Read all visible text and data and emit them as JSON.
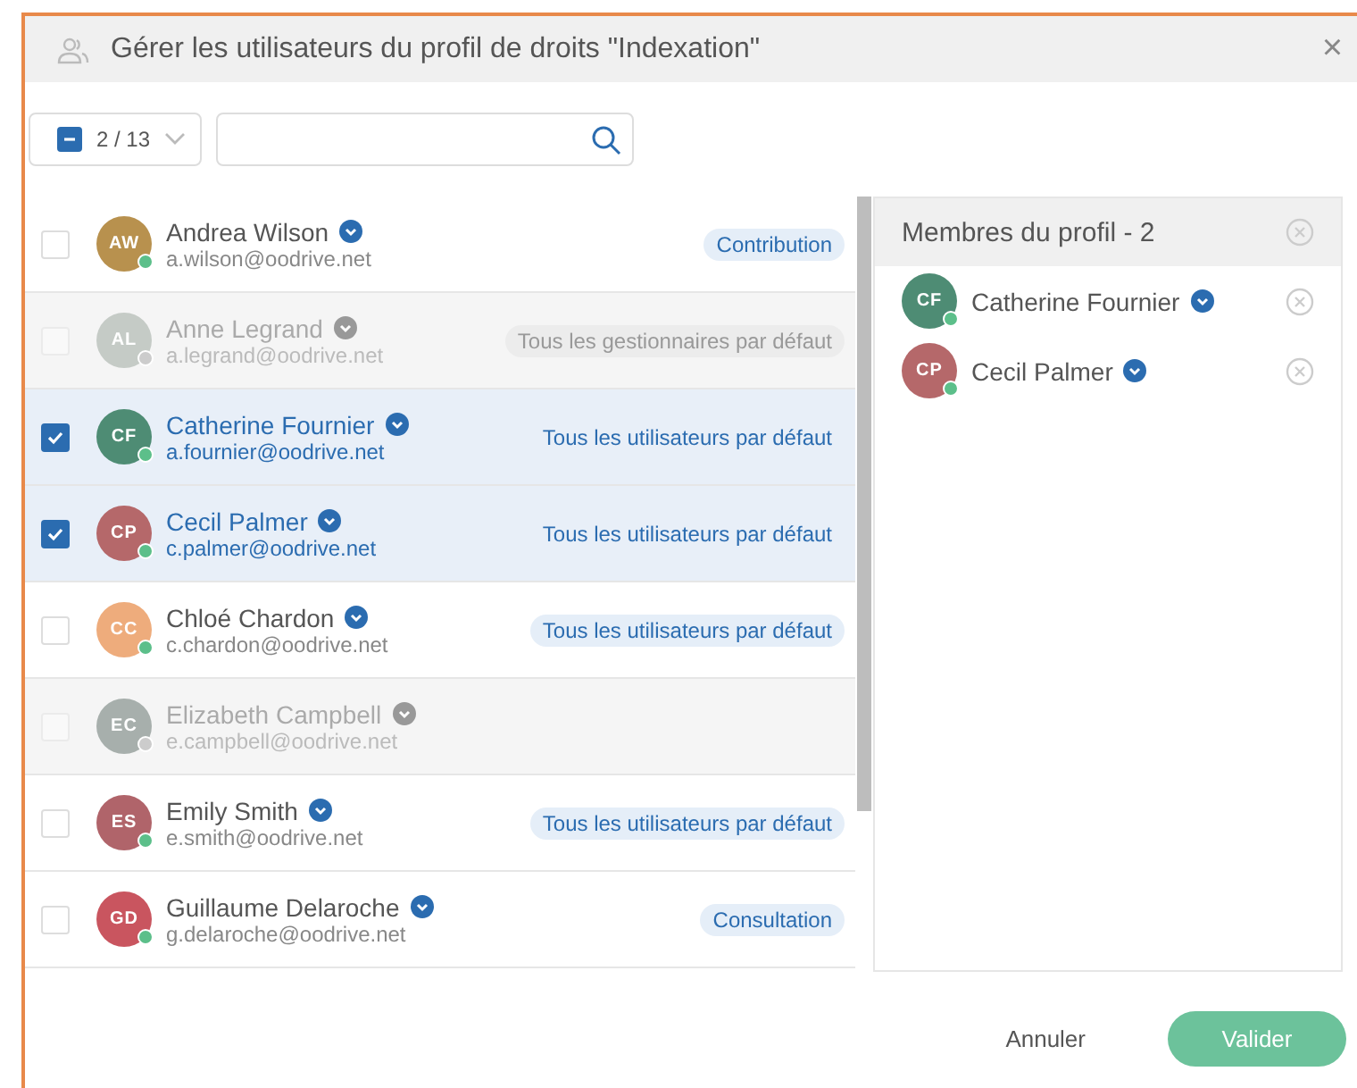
{
  "window": {
    "title": "Gérer les utilisateurs du profil de droits \"Indexation\"",
    "close": "×"
  },
  "toolbar": {
    "select_all": {
      "indeterminate": true,
      "count": "2 / 13"
    }
  },
  "users": [
    {
      "initials": "AW",
      "name": "Andrea Wilson",
      "email": "a.wilson@oodrive.net",
      "tag": "Contribution",
      "checked": false,
      "disabled": false,
      "color": "#b8914e"
    },
    {
      "initials": "AL",
      "name": "Anne Legrand",
      "email": "a.legrand@oodrive.net",
      "tag": "Tous les gestionnaires par défaut",
      "checked": false,
      "disabled": true,
      "color": "#c5cbc6"
    },
    {
      "initials": "CF",
      "name": "Catherine Fournier",
      "email": "a.fournier@oodrive.net",
      "tag": "Tous les utilisateurs par défaut",
      "checked": true,
      "disabled": false,
      "color": "#4e8c74"
    },
    {
      "initials": "CP",
      "name": "Cecil Palmer",
      "email": "c.palmer@oodrive.net",
      "tag": "Tous les utilisateurs par défaut",
      "checked": true,
      "disabled": false,
      "color": "#b5686a"
    },
    {
      "initials": "CC",
      "name": "Chloé Chardon",
      "email": "c.chardon@oodrive.net",
      "tag": "Tous les utilisateurs par défaut",
      "checked": false,
      "disabled": false,
      "color": "#eeac7c"
    },
    {
      "initials": "EC",
      "name": "Elizabeth Campbell",
      "email": "e.campbell@oodrive.net",
      "checked": false,
      "disabled": true,
      "color": "#a7afac"
    },
    {
      "initials": "ES",
      "name": "Emily Smith",
      "email": "e.smith@oodrive.net",
      "tag": "Tous les utilisateurs par défaut",
      "checked": false,
      "disabled": false,
      "color": "#b0646a"
    },
    {
      "initials": "GD",
      "name": "Guillaume Delaroche",
      "email": "g.delaroche@oodrive.net",
      "tag": "Consultation",
      "checked": false,
      "disabled": false,
      "color": "#c9555f"
    }
  ],
  "members": {
    "title": "Membres du profil - 2",
    "items": [
      {
        "initials": "CF",
        "name": "Catherine Fournier",
        "color": "#4e8c74"
      },
      {
        "initials": "CP",
        "name": "Cecil Palmer",
        "color": "#b5686a"
      }
    ]
  },
  "buttons": {
    "cancel": "Annuler",
    "confirm": "Valider"
  }
}
